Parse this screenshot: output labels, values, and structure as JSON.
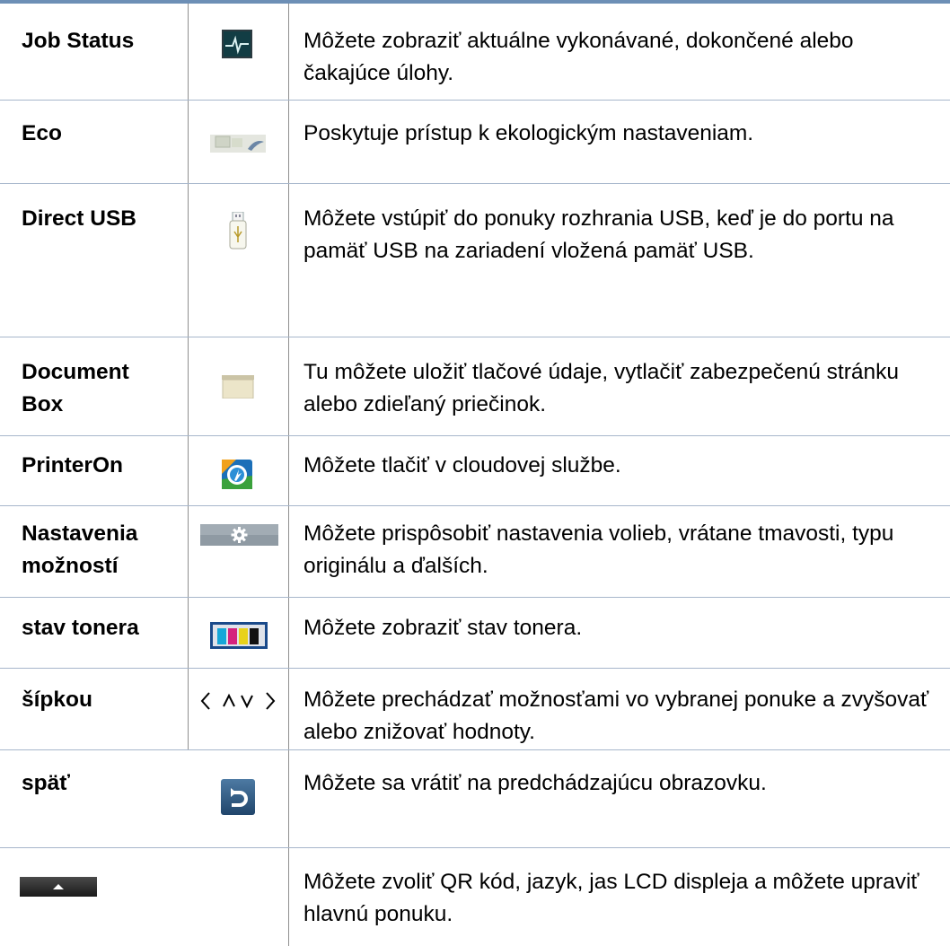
{
  "rows": [
    {
      "label": "Job Status",
      "icon": "job-status-icon",
      "description": "Môžete zobraziť aktuálne vykonávané, dokončené alebo čakajúce úlohy."
    },
    {
      "label": "Eco",
      "icon": "eco-icon",
      "description": "Poskytuje prístup k ekologickým nastaveniam."
    },
    {
      "label": "Direct USB",
      "icon": "usb-drive-icon",
      "description": "Môžete vstúpiť do ponuky rozhrania USB, keď je do portu na pamäť USB na zariadení vložená pamäť USB."
    },
    {
      "label": "Document Box",
      "label_line1": "Document",
      "label_line2": "Box",
      "icon": "document-box-icon",
      "description": "Tu môžete uložiť tlačové údaje, vytlačiť zabezpečenú stránku alebo zdieľaný priečinok."
    },
    {
      "label": "PrinterOn",
      "icon": "printeron-icon",
      "description": "Môžete tlačiť v cloudovej službe."
    },
    {
      "label": "Nastavenia možností",
      "label_line1": "Nastavenia",
      "label_line2": "možností",
      "icon": "gear-settings-icon",
      "description": "Môžete prispôsobiť nastavenia volieb, vrátane tmavosti, typu originálu a ďalších."
    },
    {
      "label": "stav tonera",
      "icon": "toner-status-icon",
      "description": "Môžete zobraziť stav tonera."
    },
    {
      "label": "šípkou",
      "icon": "arrow-keys-icon",
      "arrows": "〈 ∧ ∨ 〉",
      "description": "Môžete prechádzať možnosťami vo vybranej ponuke a zvyšovať alebo znižovať hodnoty."
    },
    {
      "label": "späť",
      "icon": "back-icon",
      "description": "Môžete sa vrátiť na predchádzajúcu obrazovku."
    },
    {
      "label": "",
      "icon": "expand-menu-icon",
      "description": "Môžete zvoliť QR kód, jazyk, jas LCD displeja a môžete upraviť hlavnú ponuku."
    }
  ]
}
